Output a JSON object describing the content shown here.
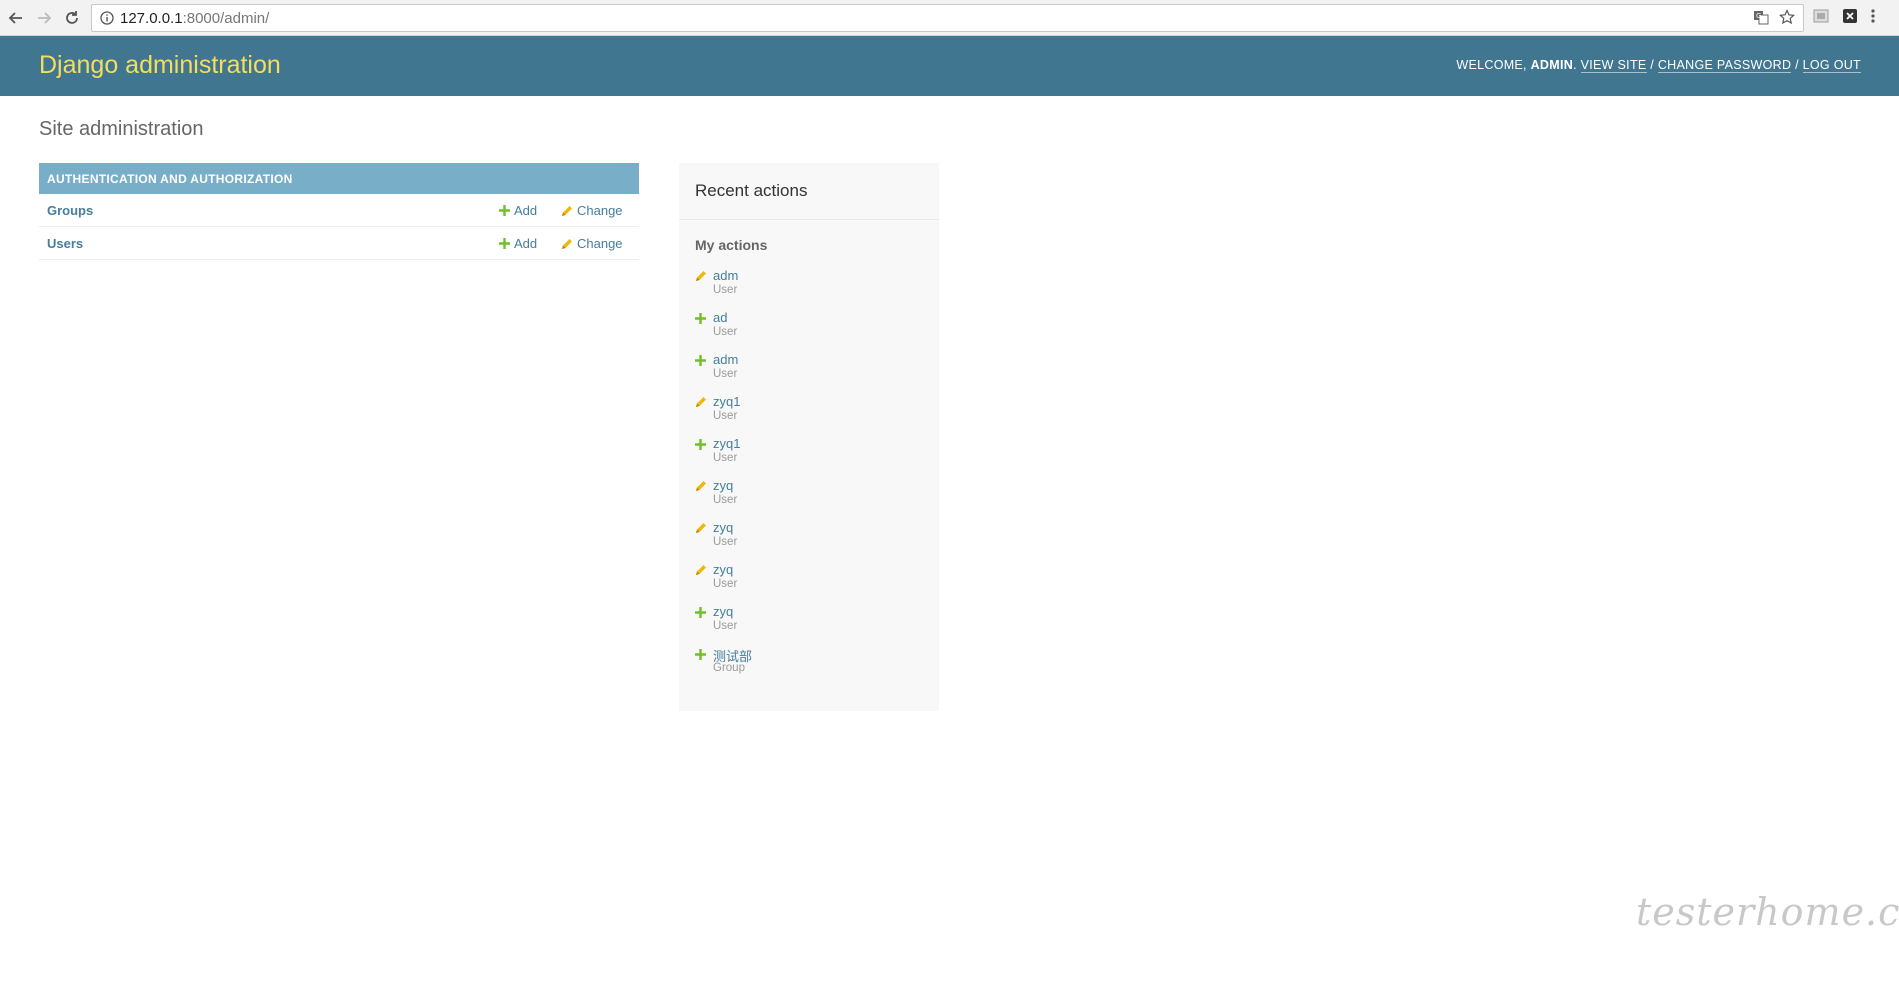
{
  "browser": {
    "url_host": "127.0.0.1",
    "url_path": ":8000/admin/",
    "icons": [
      "back-icon",
      "forward-icon",
      "reload-icon",
      "info-icon",
      "translate-icon",
      "star-icon",
      "extension-icon",
      "close-extension-icon",
      "menu-icon"
    ]
  },
  "header": {
    "branding": "Django administration",
    "welcome": "Welcome, ",
    "username": "admin",
    "view_site": "View site",
    "change_password": "Change password",
    "log_out": "Log out",
    "separator": " / ",
    "colors": {
      "bg": "#417690",
      "branding": "#f5dd5d"
    }
  },
  "content": {
    "title": "Site administration",
    "module": {
      "caption": "Authentication and Authorization",
      "models": [
        {
          "name": "Groups",
          "add": "Add",
          "change": "Change"
        },
        {
          "name": "Users",
          "add": "Add",
          "change": "Change"
        }
      ]
    }
  },
  "recent": {
    "title": "Recent actions",
    "subtitle": "My actions",
    "actions": [
      {
        "icon": "change-icon",
        "name": "adm",
        "type": "User"
      },
      {
        "icon": "add-icon",
        "name": "ad",
        "type": "User"
      },
      {
        "icon": "add-icon",
        "name": "adm",
        "type": "User"
      },
      {
        "icon": "change-icon",
        "name": "zyq1",
        "type": "User"
      },
      {
        "icon": "add-icon",
        "name": "zyq1",
        "type": "User"
      },
      {
        "icon": "change-icon",
        "name": "zyq",
        "type": "User"
      },
      {
        "icon": "change-icon",
        "name": "zyq",
        "type": "User"
      },
      {
        "icon": "change-icon",
        "name": "zyq",
        "type": "User"
      },
      {
        "icon": "add-icon",
        "name": "zyq",
        "type": "User"
      },
      {
        "icon": "add-icon",
        "name": "测试部",
        "type": "Group"
      }
    ]
  },
  "watermark": "testerhome.com"
}
